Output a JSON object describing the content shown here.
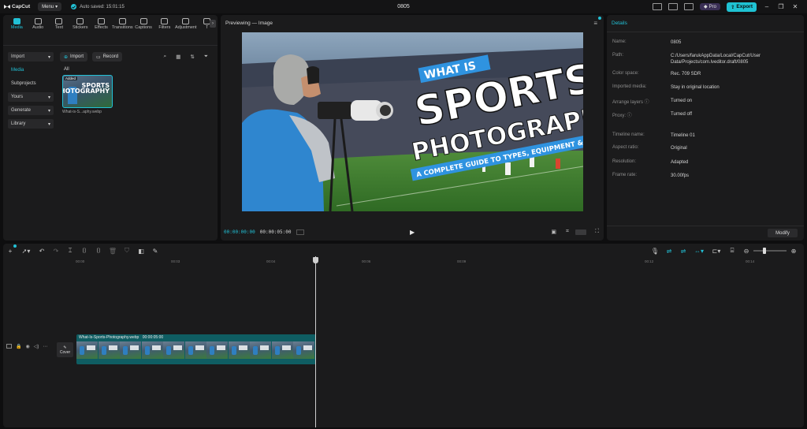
{
  "titlebar": {
    "app_name": "CapCut",
    "menu_label": "Menu",
    "autosave_text": "Auto saved: 15:01:15",
    "project_name": "0805",
    "pro_label": "Pro",
    "export_label": "Export"
  },
  "toolbar_tabs": [
    {
      "label": "Media",
      "icon": "media-icon",
      "active": true
    },
    {
      "label": "Audio",
      "icon": "audio-icon"
    },
    {
      "label": "Text",
      "icon": "text-icon"
    },
    {
      "label": "Stickers",
      "icon": "stickers-icon"
    },
    {
      "label": "Effects",
      "icon": "effects-icon"
    },
    {
      "label": "Transitions",
      "icon": "transitions-icon"
    },
    {
      "label": "Captions",
      "icon": "captions-icon"
    },
    {
      "label": "Filters",
      "icon": "filters-icon"
    },
    {
      "label": "Adjustment",
      "icon": "adjustment-icon"
    },
    {
      "label": "T",
      "icon": "templates-icon"
    }
  ],
  "media_sidebar": [
    {
      "label": "Import",
      "boxed": true,
      "chevron": true
    },
    {
      "label": "Media",
      "active": true
    },
    {
      "label": "Subprojects"
    },
    {
      "label": "Yours",
      "boxed": true,
      "chevron": true
    },
    {
      "label": "Generate",
      "boxed": true,
      "chevron": true
    },
    {
      "label": "Library",
      "boxed": true,
      "chevron": true
    }
  ],
  "media": {
    "import_label": "Import",
    "record_label": "Record",
    "filter_all": "All",
    "item": {
      "added_badge": "Added",
      "filename": "What-is-S...aphy.webp",
      "thumb_text": "SPORTS PHOTOGRAPHY"
    }
  },
  "preview": {
    "title": "Previewing — Image",
    "image_text": {
      "what_is": "WHAT IS",
      "sports": "SPORTS",
      "photography": "PHOTOGRAPHY?",
      "subtitle": "A COMPLETE GUIDE TO TYPES, EQUIPMENT & SKILLS"
    },
    "time_current": "00:00:00:00",
    "time_total": "00:00:05:00"
  },
  "details": {
    "title": "Details",
    "rows": [
      {
        "key": "Name:",
        "value": "0805"
      },
      {
        "key": "Path:",
        "value": "C:/Users/farukAppData/Local/CapCut/User Data/Projects/com.lveditor.draft/0805"
      },
      {
        "key": "Color space:",
        "value": "Rec. 709 SDR"
      },
      {
        "key": "Imported media:",
        "value": "Stay in original location"
      },
      {
        "key": "Arrange layers ⓘ",
        "value": "Turned on"
      },
      {
        "key": "Proxy: ⓘ",
        "value": "Turned off"
      },
      {
        "key": "Timeline name:",
        "value": "Timeline 01"
      },
      {
        "key": "Aspect ratio:",
        "value": "Original"
      },
      {
        "key": "Resolution:",
        "value": "Adapted"
      },
      {
        "key": "Frame rate:",
        "value": "30.00fps"
      }
    ],
    "modify_label": "Modify"
  },
  "timeline": {
    "ruler_ticks": [
      "00:00",
      "00:03",
      "00:04",
      "00:06",
      "00:09",
      "00:12",
      "00:14"
    ],
    "clip_label": "What-Is-Sports-Photography.webp",
    "clip_duration": "00:00:05:00",
    "cover_label": "Cover"
  },
  "colors": {
    "accent": "#22c1d6",
    "panel": "#1b1b1c",
    "background": "#0e0e0f",
    "clip": "#0f5d62"
  }
}
